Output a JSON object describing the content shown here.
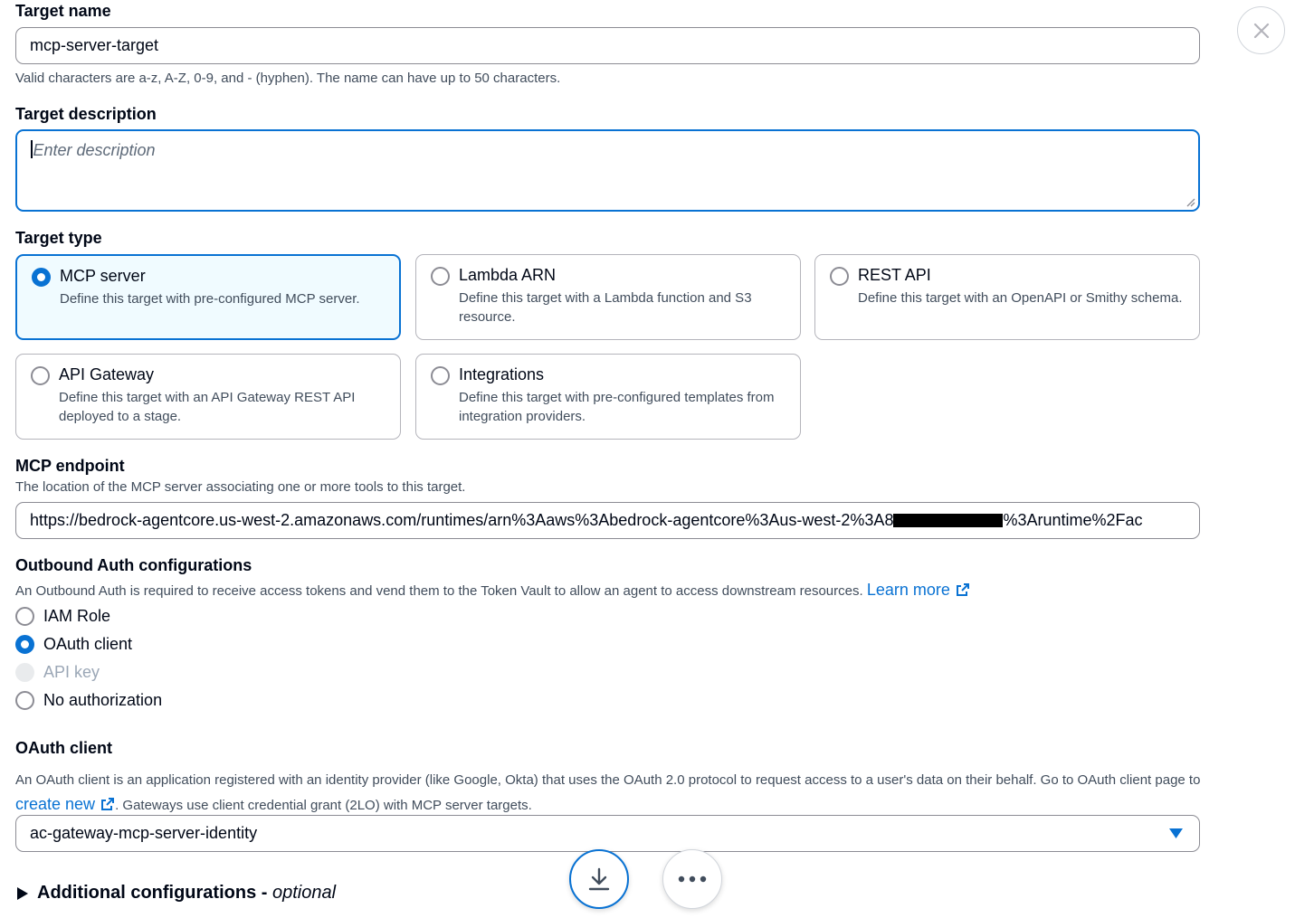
{
  "target_name": {
    "label": "Target name",
    "value": "mcp-server-target",
    "hint": "Valid characters are a-z, A-Z, 0-9, and - (hyphen). The name can have up to 50 characters."
  },
  "target_description": {
    "label": "Target description",
    "placeholder": "Enter description"
  },
  "target_type": {
    "label": "Target type",
    "options": [
      {
        "title": "MCP server",
        "description": "Define this target with pre-configured MCP server.",
        "selected": true
      },
      {
        "title": "Lambda ARN",
        "description": "Define this target with a Lambda function and S3 resource.",
        "selected": false
      },
      {
        "title": "REST API",
        "description": "Define this target with an OpenAPI or Smithy schema.",
        "selected": false
      },
      {
        "title": "API Gateway",
        "description": "Define this target with an API Gateway REST API deployed to a stage.",
        "selected": false
      },
      {
        "title": "Integrations",
        "description": "Define this target with pre-configured templates from integration providers.",
        "selected": false
      }
    ]
  },
  "mcp_endpoint": {
    "label": "MCP endpoint",
    "hint": "The location of the MCP server associating one or more tools to this target.",
    "value_prefix": "https://bedrock-agentcore.us-west-2.amazonaws.com/runtimes/arn%3Aaws%3Abedrock-agentcore%3Aus-west-2%3A8",
    "value_suffix": "%3Aruntime%2Fac"
  },
  "outbound_auth": {
    "label": "Outbound Auth configurations",
    "hint": "An Outbound Auth is required to receive access tokens and vend them to the Token Vault to allow an agent to access downstream resources.",
    "learn_more": "Learn more",
    "options": [
      {
        "label": "IAM Role",
        "state": "unselected"
      },
      {
        "label": "OAuth client",
        "state": "selected"
      },
      {
        "label": "API key",
        "state": "disabled"
      },
      {
        "label": "No authorization",
        "state": "unselected"
      }
    ]
  },
  "oauth_client": {
    "label": "OAuth client",
    "hint_part1": "An OAuth client is an application registered with an identity provider (like Google, Okta) that uses the OAuth 2.0 protocol to request access to a user's data on their behalf. Go to OAuth client page to",
    "create_new": "create new",
    "hint_part2": ". Gateways use client credential grant (2LO) with MCP server targets.",
    "selected_value": "ac-gateway-mcp-server-identity"
  },
  "additional_config": {
    "label": "Additional configurations",
    "separator": " - ",
    "optional": "optional"
  },
  "colors": {
    "accent": "#0972d3",
    "text": "#000716",
    "secondary_text": "#414d5c",
    "selected_tile_bg": "#f0fbff"
  }
}
